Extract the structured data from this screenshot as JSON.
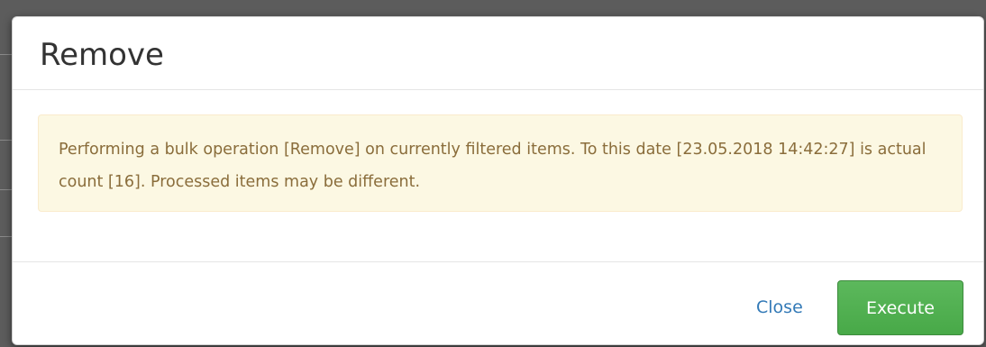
{
  "dialog": {
    "title": "Remove",
    "message": "Performing a bulk operation [Remove] on currently filtered items. To this date [23.05.2018 14:42:27] is actual count [16]. Processed items may be different.",
    "close_label": "Close",
    "execute_label": "Execute"
  },
  "colors": {
    "alert_background": "#fcf8e3",
    "alert_text": "#8a6d3b",
    "execute_button": "#5cb85c",
    "close_link": "#337ab7"
  }
}
